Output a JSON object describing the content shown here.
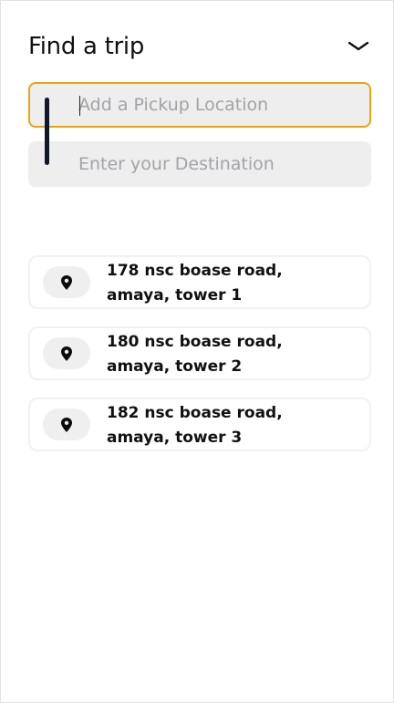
{
  "header": {
    "title": "Find a trip",
    "collapse_icon": "chevron-down-icon"
  },
  "trip": {
    "pickup_placeholder": "Add a Pickup Location",
    "pickup_value": "",
    "destination_placeholder": "Enter your Destination",
    "destination_value": ""
  },
  "suggestions": [
    {
      "address": "178 nsc boase road, amaya, tower 1",
      "icon": "location-pin-icon"
    },
    {
      "address": "180 nsc boase road, amaya, tower 2",
      "icon": "location-pin-icon"
    },
    {
      "address": "182 nsc boase road, amaya, tower 3",
      "icon": "location-pin-icon"
    }
  ],
  "colors": {
    "focus_border": "#e8a317",
    "field_background": "#eeeeee",
    "route_line": "#111827",
    "pin_badge_background": "#efefef"
  }
}
